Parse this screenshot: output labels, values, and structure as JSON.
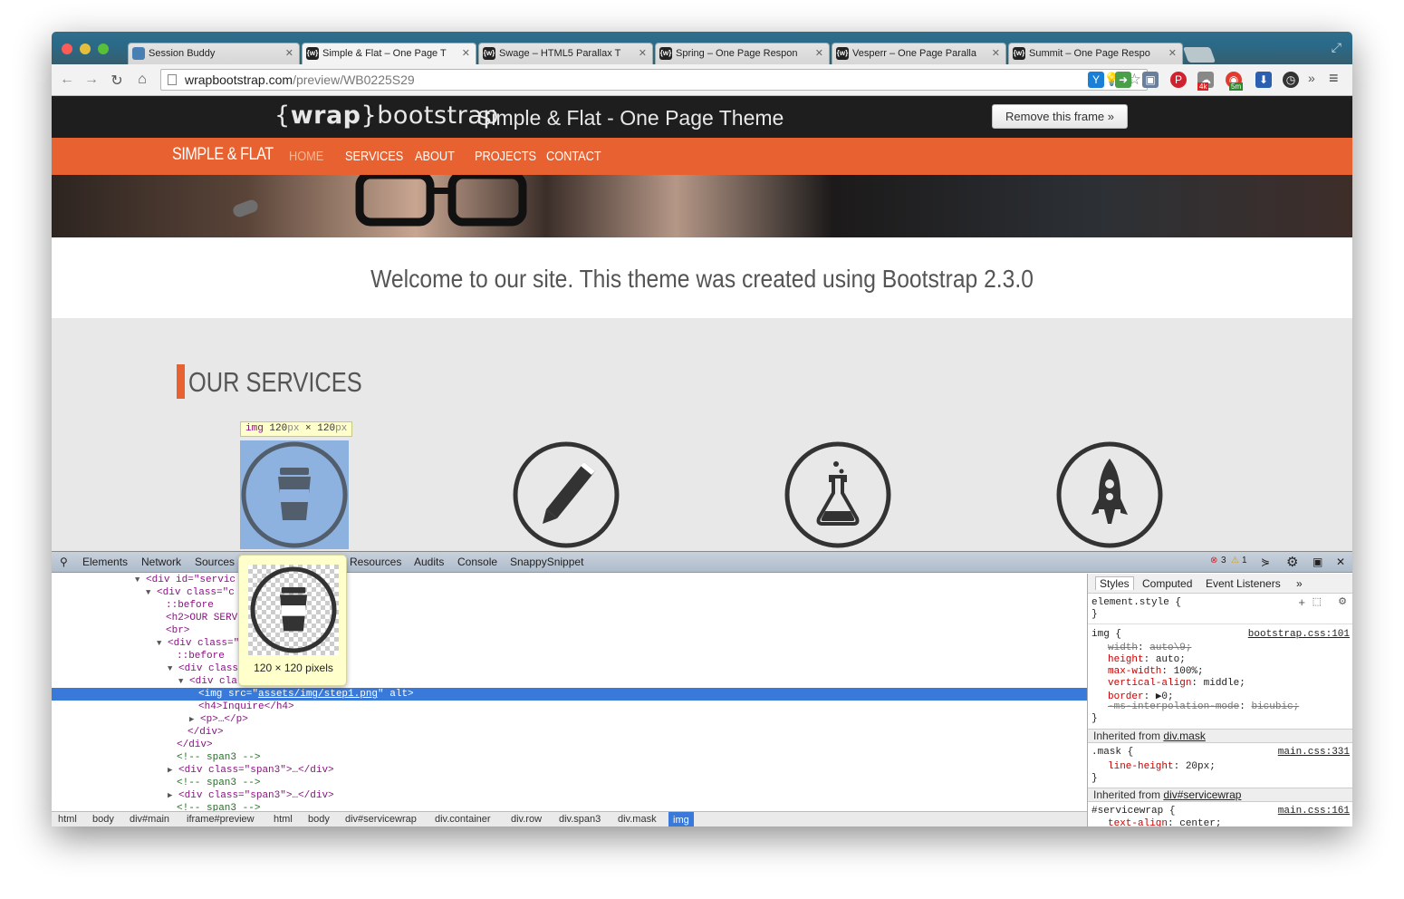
{
  "browser": {
    "tabs": [
      {
        "title": "Session Buddy",
        "favicon": "session-buddy-icon"
      },
      {
        "title": "Simple & Flat – One Page T",
        "favicon": "wrap-icon",
        "active": true
      },
      {
        "title": "Swage – HTML5 Parallax T",
        "favicon": "wrap-icon"
      },
      {
        "title": "Spring – One Page Respon",
        "favicon": "wrap-icon"
      },
      {
        "title": "Vesperr – One Page Paralla",
        "favicon": "wrap-icon"
      },
      {
        "title": "Summit – One Page Respo",
        "favicon": "wrap-icon"
      }
    ],
    "url_host": "wrapbootstrap.com",
    "url_path": "/preview/WB0225S29",
    "extension_badges": {
      "badge1": "4k",
      "badge2": "5m"
    }
  },
  "wrapbar": {
    "logo_brace_open": "{",
    "logo_wrap": "wrap",
    "logo_brace_close": "}",
    "logo_bootstrap": "bootstrap",
    "title": "Simple & Flat - One Page Theme",
    "remove_button": "Remove this frame »"
  },
  "site": {
    "brand": "SIMPLE & FLAT",
    "nav": [
      "HOME",
      "SERVICES",
      "ABOUT",
      "PROJECTS",
      "CONTACT"
    ],
    "welcome": "Welcome to our site. This theme was created using Bootstrap 2.3.0",
    "services_heading": "OUR SERVICES",
    "service_icons": [
      "coffee-cup-icon",
      "pencil-icon",
      "flask-icon",
      "rocket-icon"
    ]
  },
  "inspector": {
    "highlight_tag": "img",
    "highlight_w": "120",
    "highlight_h": "120",
    "px": "px",
    "times": " × ",
    "preview_caption": "120 × 120 pixels"
  },
  "devtools": {
    "tabs": [
      "Elements",
      "Network",
      "Sources",
      "Resources",
      "Audits",
      "Console",
      "SnappySnippet"
    ],
    "error_count": "3",
    "warning_count": "1",
    "dom_lines": [
      "<div id=\"servic",
      "<div class=\"c",
      "::before",
      "<h2>OUR SERV",
      "<br>",
      "<div class=\"",
      "::before",
      "<div class",
      "<div cla",
      "<img src=\"",
      "assets/img/step1.png",
      "\" alt>",
      "<h4>Inquire</h4>",
      "<p>…</p>",
      "</div>",
      "</div>",
      "<!-- span3 -->",
      "<div class=\"span3\">…</div>",
      "<!-- span3 -->",
      "<div class=\"span3\">…</div>",
      "<!-- span3 -->"
    ],
    "breadcrumbs": [
      "html",
      "body",
      "div#main",
      "iframe#preview",
      "html",
      "body",
      "div#servicewrap",
      "div.container",
      "div.row",
      "div.span3",
      "div.mask",
      "img"
    ],
    "styles_tabs": [
      "Styles",
      "Computed",
      "Event Listeners",
      "»"
    ],
    "styles": {
      "element_style": "element.style {",
      "close": "}",
      "img_rule": "img {",
      "img_src": "bootstrap.css:101",
      "img_props": [
        {
          "p": "width",
          "v": "auto\\9;"
        },
        {
          "p": "height",
          "v": "auto;"
        },
        {
          "p": "max-width",
          "v": "100%;"
        },
        {
          "p": "vertical-align",
          "v": "middle;"
        },
        {
          "p": "border",
          "v": "▶0;"
        },
        {
          "p": "-ms-interpolation-mode",
          "v": "bicubic;"
        }
      ],
      "inherited_1_label": "Inherited from",
      "inherited_1_link": "div.mask",
      "mask_rule": ".mask {",
      "mask_src": "main.css:331",
      "mask_prop": "line-height",
      "mask_val": "20px;",
      "inherited_2_label": "Inherited from",
      "inherited_2_link": "div#servicewrap",
      "sw_rule": "#servicewrap {",
      "sw_src": "main.css:161",
      "sw_prop": "text-align",
      "sw_val": "center;"
    }
  }
}
